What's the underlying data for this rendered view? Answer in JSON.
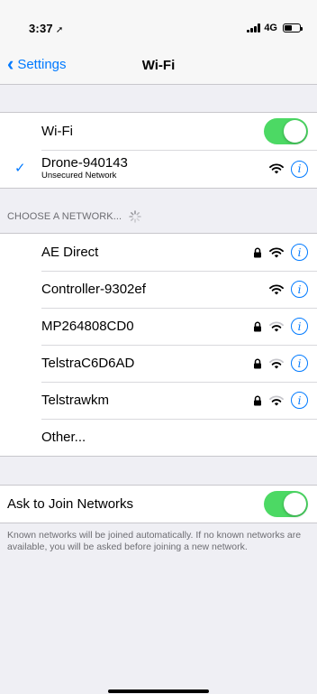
{
  "status_bar": {
    "time": "3:37",
    "location_icon": "location-arrow-icon",
    "network_type": "4G"
  },
  "nav": {
    "back_label": "Settings",
    "title": "Wi-Fi"
  },
  "wifi_toggle": {
    "label": "Wi-Fi",
    "on": true
  },
  "connected_network": {
    "name": "Drone-940143",
    "subtitle": "Unsecured Network",
    "secured": false
  },
  "choose_header": "CHOOSE A NETWORK...",
  "networks": [
    {
      "name": "AE Direct",
      "secured": true
    },
    {
      "name": "Controller-9302ef",
      "secured": false
    },
    {
      "name": "MP264808CD0",
      "secured": true
    },
    {
      "name": "TelstraC6D6AD",
      "secured": true
    },
    {
      "name": "Telstrawkm",
      "secured": true
    }
  ],
  "other_label": "Other...",
  "ask_to_join": {
    "label": "Ask to Join Networks",
    "on": true
  },
  "footer_note": "Known networks will be joined automatically. If no known networks are available, you will be asked before joining a new network.",
  "colors": {
    "accent": "#007aff",
    "toggle_on": "#4cd964",
    "background": "#efeff4"
  },
  "info_glyph": "i"
}
